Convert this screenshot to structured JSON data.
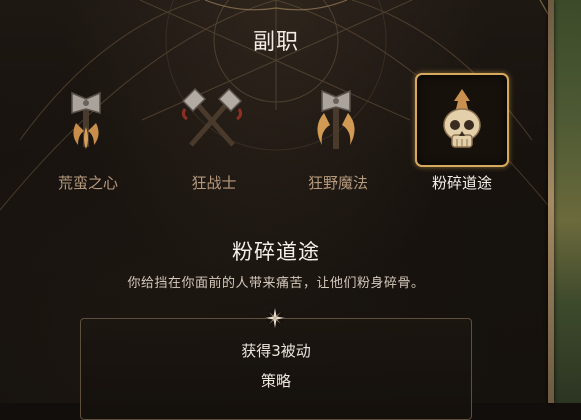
{
  "header": {
    "title": "副职"
  },
  "subclasses": [
    {
      "label": "荒蛮之心",
      "icon": "axe-claw-icon",
      "selected": false
    },
    {
      "label": "狂战士",
      "icon": "crossed-axes-icon",
      "selected": false
    },
    {
      "label": "狂野魔法",
      "icon": "axe-flame-icon",
      "selected": false
    },
    {
      "label": "粉碎道途",
      "icon": "skull-icon",
      "selected": true
    }
  ],
  "selected": {
    "name": "粉碎道途",
    "description": "你给挡在你面前的人带来痛苦，让他们粉身碎骨。"
  },
  "info": {
    "gain_label": "获得3被动",
    "tactic_label": "策略"
  },
  "colors": {
    "accent_gold": "#d7a95c",
    "label_inactive": "#b59a7e",
    "text_light": "#f4efe8"
  }
}
